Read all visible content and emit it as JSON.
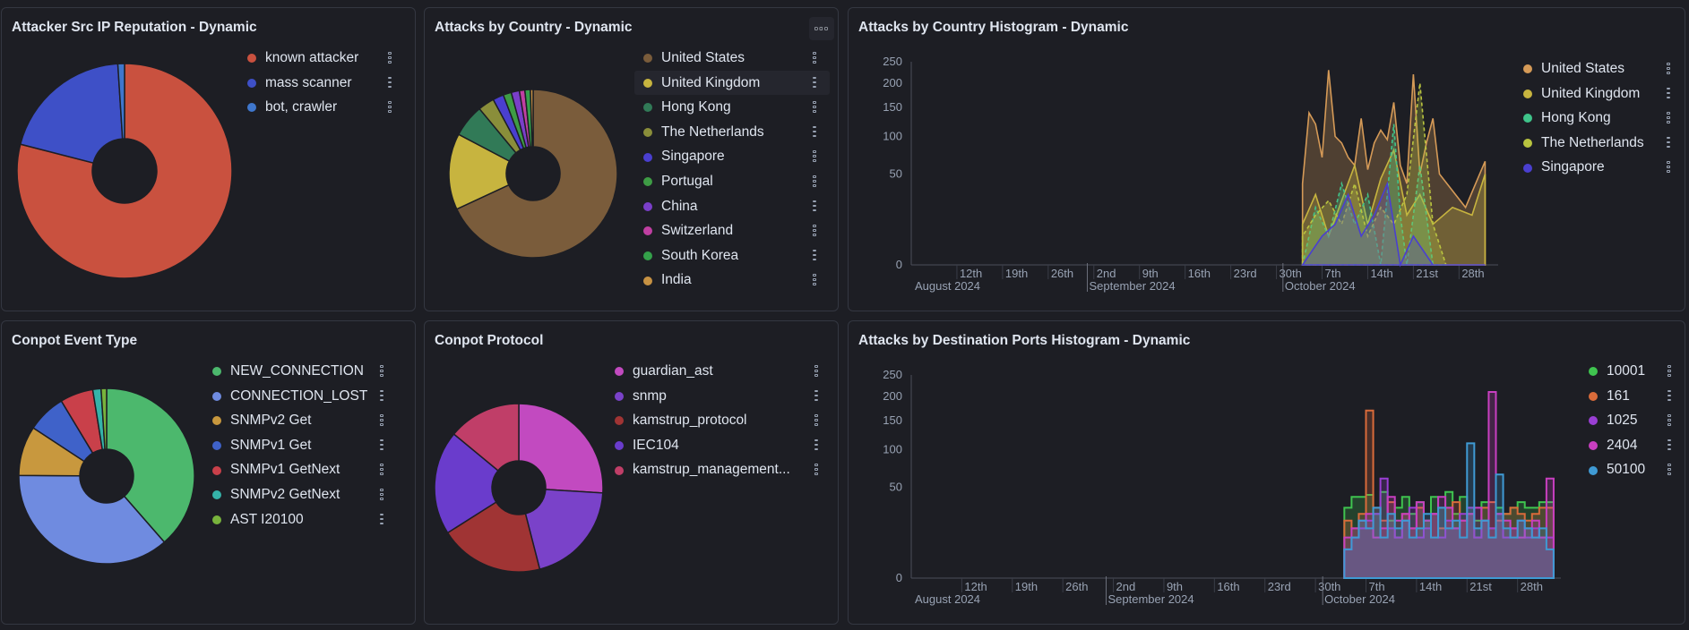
{
  "panels": {
    "reputation": {
      "title": "Attacker Src IP Reputation - Dynamic"
    },
    "countries": {
      "title": "Attacks by Country - Dynamic"
    },
    "country_hist": {
      "title": "Attacks by Country Histogram - Dynamic"
    },
    "event_type": {
      "title": "Conpot Event Type"
    },
    "protocol": {
      "title": "Conpot Protocol"
    },
    "ports_hist": {
      "title": "Attacks by Destination Ports Histogram - Dynamic"
    }
  },
  "chart_data": [
    {
      "type": "pie",
      "donut": true,
      "title": "Attacker Src IP Reputation - Dynamic",
      "legend_position": "right",
      "labels": [
        "known attacker",
        "mass scanner",
        "bot, crawler"
      ],
      "values": [
        79,
        20,
        1
      ],
      "colors": [
        "#c9513f",
        "#3e50c7",
        "#3f77cd"
      ]
    },
    {
      "type": "pie",
      "donut": true,
      "title": "Attacks by Country - Dynamic",
      "legend_position": "right",
      "labels": [
        "United States",
        "United Kingdom",
        "Hong Kong",
        "The Netherlands",
        "Singapore",
        "Portugal",
        "China",
        "Switzerland",
        "South Korea",
        "India"
      ],
      "values": [
        65,
        14,
        6,
        3,
        2,
        1.5,
        1.5,
        1,
        1,
        0.5
      ],
      "colors": [
        "#7a5c3b",
        "#c7b43f",
        "#317a57",
        "#8a8e3a",
        "#4a3fd0",
        "#3e9c45",
        "#7a3fc9",
        "#c03fa2",
        "#34a04a",
        "#c79243"
      ]
    },
    {
      "type": "area",
      "title": "Attacks by Country Histogram - Dynamic",
      "legend_position": "top-right",
      "y_scale": "sqrt",
      "ylim": [
        0,
        250
      ],
      "y_ticks": [
        0,
        50,
        100,
        150,
        200,
        250
      ],
      "x_tick_labels": [
        "12th",
        "19th",
        "26th",
        "2nd",
        "9th",
        "16th",
        "23rd",
        "30th",
        "7th",
        "14th",
        "21st",
        "28th"
      ],
      "x_major_labels": [
        "August 2024",
        "September 2024",
        "October 2024"
      ],
      "x_start": "2024-08-05",
      "x_end": "2024-11-03",
      "series": [
        {
          "name": "United States",
          "color": "#d59a57",
          "x": [
            "2024-10-04",
            "2024-10-05",
            "2024-10-06",
            "2024-10-07",
            "2024-10-08",
            "2024-10-09",
            "2024-10-10",
            "2024-10-11",
            "2024-10-12",
            "2024-10-13",
            "2024-10-14",
            "2024-10-15",
            "2024-10-16",
            "2024-10-17",
            "2024-10-18",
            "2024-10-19",
            "2024-10-20",
            "2024-10-21",
            "2024-10-22",
            "2024-10-23",
            "2024-10-24",
            "2024-10-25",
            "2024-10-29",
            "2024-11-01"
          ],
          "y": [
            40,
            140,
            120,
            70,
            230,
            100,
            90,
            70,
            60,
            130,
            55,
            90,
            110,
            95,
            160,
            60,
            40,
            220,
            50,
            90,
            130,
            50,
            20,
            65
          ]
        },
        {
          "name": "United Kingdom",
          "color": "#c7b43f",
          "x": [
            "2024-10-04",
            "2024-10-06",
            "2024-10-08",
            "2024-10-10",
            "2024-10-12",
            "2024-10-14",
            "2024-10-16",
            "2024-10-18",
            "2024-10-20",
            "2024-10-22",
            "2024-10-24",
            "2024-10-27",
            "2024-10-30",
            "2024-11-01"
          ],
          "y": [
            10,
            30,
            5,
            25,
            60,
            10,
            45,
            80,
            15,
            30,
            10,
            20,
            15,
            50
          ]
        },
        {
          "name": "Hong Kong",
          "color": "#3fc48a",
          "x": [
            "2024-10-04",
            "2024-10-06",
            "2024-10-08",
            "2024-10-10",
            "2024-10-12",
            "2024-10-14",
            "2024-10-16",
            "2024-10-18",
            "2024-10-19",
            "2024-10-20",
            "2024-10-22",
            "2024-10-24",
            "2024-10-26"
          ],
          "y": [
            0,
            20,
            5,
            40,
            10,
            30,
            0,
            120,
            15,
            0,
            60,
            0,
            0
          ]
        },
        {
          "name": "The Netherlands",
          "color": "#b9c43f",
          "x": [
            "2024-10-04",
            "2024-10-06",
            "2024-10-08",
            "2024-10-10",
            "2024-10-12",
            "2024-10-14",
            "2024-10-16",
            "2024-10-18",
            "2024-10-20",
            "2024-10-22",
            "2024-10-24",
            "2024-10-26"
          ],
          "y": [
            5,
            15,
            25,
            10,
            40,
            5,
            20,
            10,
            30,
            200,
            10,
            0
          ]
        },
        {
          "name": "Singapore",
          "color": "#4a3fd0",
          "x": [
            "2024-10-04",
            "2024-10-07",
            "2024-10-09",
            "2024-10-11",
            "2024-10-13",
            "2024-10-15",
            "2024-10-17",
            "2024-10-19",
            "2024-10-21",
            "2024-10-24",
            "2024-10-28",
            "2024-11-01"
          ],
          "y": [
            0,
            5,
            10,
            30,
            5,
            15,
            40,
            0,
            5,
            0,
            0,
            0
          ]
        }
      ]
    },
    {
      "type": "pie",
      "donut": true,
      "title": "Conpot Event Type",
      "legend_position": "right",
      "labels": [
        "NEW_CONNECTION",
        "CONNECTION_LOST",
        "SNMPv2 Get",
        "SNMPv1 Get",
        "SNMPv1 GetNext",
        "SNMPv2 GetNext",
        "AST I20100"
      ],
      "values": [
        38,
        36,
        9,
        7,
        6,
        1.5,
        1
      ],
      "colors": [
        "#4cb86d",
        "#6f8be0",
        "#c8983e",
        "#3f62c9",
        "#c9404a",
        "#35b3a9",
        "#78b33c"
      ]
    },
    {
      "type": "pie",
      "donut": true,
      "title": "Conpot Protocol",
      "legend_position": "right",
      "labels": [
        "guardian_ast",
        "snmp",
        "kamstrup_protocol",
        "IEC104",
        "kamstrup_management..."
      ],
      "values": [
        26,
        20,
        20,
        20,
        14
      ],
      "colors": [
        "#c24ac0",
        "#7a42c9",
        "#a03434",
        "#6a3ccc",
        "#c03e68"
      ]
    },
    {
      "type": "bar",
      "title": "Attacks by Destination Ports Histogram - Dynamic",
      "legend_position": "top-right",
      "y_scale": "sqrt",
      "ylim": [
        0,
        250
      ],
      "y_ticks": [
        0,
        50,
        100,
        150,
        200,
        250
      ],
      "x_tick_labels": [
        "12th",
        "19th",
        "26th",
        "2nd",
        "9th",
        "16th",
        "23rd",
        "30th",
        "7th",
        "14th",
        "21st",
        "28th"
      ],
      "x_major_labels": [
        "August 2024",
        "September 2024",
        "October 2024"
      ],
      "x_start": "2024-08-05",
      "x_end": "2024-11-03",
      "series": [
        {
          "name": "10001",
          "color": "#3fc44f",
          "x": [
            "2024-10-04",
            "2024-10-05",
            "2024-10-06",
            "2024-10-07",
            "2024-10-08",
            "2024-10-09",
            "2024-10-10",
            "2024-10-11",
            "2024-10-12",
            "2024-10-13",
            "2024-10-14",
            "2024-10-15",
            "2024-10-16",
            "2024-10-17",
            "2024-10-18",
            "2024-10-19",
            "2024-10-20",
            "2024-10-21",
            "2024-10-22",
            "2024-10-23",
            "2024-10-24",
            "2024-10-25",
            "2024-10-26",
            "2024-10-27",
            "2024-10-28",
            "2024-10-29",
            "2024-10-30",
            "2024-10-31",
            "2024-11-01"
          ],
          "y": [
            30,
            40,
            40,
            42,
            25,
            45,
            20,
            30,
            40,
            25,
            35,
            20,
            40,
            30,
            45,
            25,
            40,
            30,
            20,
            35,
            15,
            30,
            25,
            30,
            35,
            30,
            30,
            35,
            35
          ]
        },
        {
          "name": "161",
          "color": "#d96b3a",
          "x": [
            "2024-10-04",
            "2024-10-05",
            "2024-10-06",
            "2024-10-07",
            "2024-10-08",
            "2024-10-09",
            "2024-10-10",
            "2024-10-11",
            "2024-10-12",
            "2024-10-13",
            "2024-10-14",
            "2024-10-15",
            "2024-10-16",
            "2024-10-17",
            "2024-10-18",
            "2024-10-19",
            "2024-10-20",
            "2024-10-21",
            "2024-10-22",
            "2024-10-23",
            "2024-10-24",
            "2024-10-25",
            "2024-10-26",
            "2024-10-27",
            "2024-10-28",
            "2024-10-29",
            "2024-10-30",
            "2024-10-31",
            "2024-11-01"
          ],
          "y": [
            20,
            15,
            25,
            170,
            30,
            20,
            35,
            10,
            25,
            15,
            30,
            20,
            25,
            15,
            30,
            35,
            20,
            25,
            10,
            30,
            35,
            20,
            25,
            30,
            25,
            20,
            25,
            30,
            30
          ]
        },
        {
          "name": "1025",
          "color": "#9a3fd4",
          "x": [
            "2024-10-04",
            "2024-10-05",
            "2024-10-06",
            "2024-10-07",
            "2024-10-08",
            "2024-10-09",
            "2024-10-10",
            "2024-10-11",
            "2024-10-12",
            "2024-10-13",
            "2024-10-14",
            "2024-10-15",
            "2024-10-16",
            "2024-10-17",
            "2024-10-18",
            "2024-10-19",
            "2024-10-20",
            "2024-10-21",
            "2024-10-22",
            "2024-10-23",
            "2024-10-24",
            "2024-10-25",
            "2024-10-26",
            "2024-10-27",
            "2024-10-28",
            "2024-10-29",
            "2024-10-30",
            "2024-10-31",
            "2024-11-01"
          ],
          "y": [
            5,
            10,
            15,
            20,
            25,
            60,
            15,
            10,
            20,
            30,
            10,
            15,
            25,
            10,
            20,
            15,
            25,
            30,
            10,
            20,
            15,
            25,
            10,
            15,
            20,
            10,
            15,
            10,
            10
          ]
        },
        {
          "name": "2404",
          "color": "#c83fc0",
          "x": [
            "2024-10-04",
            "2024-10-05",
            "2024-10-06",
            "2024-10-07",
            "2024-10-08",
            "2024-10-09",
            "2024-10-10",
            "2024-10-11",
            "2024-10-12",
            "2024-10-13",
            "2024-10-14",
            "2024-10-15",
            "2024-10-16",
            "2024-10-17",
            "2024-10-18",
            "2024-10-19",
            "2024-10-20",
            "2024-10-21",
            "2024-10-22",
            "2024-10-23",
            "2024-10-24",
            "2024-10-25",
            "2024-10-26",
            "2024-10-27",
            "2024-10-28",
            "2024-10-29",
            "2024-10-30",
            "2024-10-31",
            "2024-11-01"
          ],
          "y": [
            10,
            15,
            20,
            25,
            10,
            15,
            40,
            20,
            25,
            15,
            35,
            20,
            25,
            40,
            30,
            15,
            20,
            25,
            30,
            20,
            210,
            25,
            20,
            15,
            10,
            15,
            20,
            10,
            60
          ]
        },
        {
          "name": "50100",
          "color": "#3f9ad4",
          "x": [
            "2024-10-04",
            "2024-10-05",
            "2024-10-06",
            "2024-10-07",
            "2024-10-08",
            "2024-10-09",
            "2024-10-10",
            "2024-10-11",
            "2024-10-12",
            "2024-10-13",
            "2024-10-14",
            "2024-10-15",
            "2024-10-16",
            "2024-10-17",
            "2024-10-18",
            "2024-10-19",
            "2024-10-20",
            "2024-10-21",
            "2024-10-22",
            "2024-10-23",
            "2024-10-24",
            "2024-10-25",
            "2024-10-26",
            "2024-10-27",
            "2024-10-28",
            "2024-10-29",
            "2024-10-30",
            "2024-10-31",
            "2024-11-01"
          ],
          "y": [
            5,
            10,
            20,
            15,
            30,
            10,
            25,
            15,
            20,
            10,
            15,
            25,
            10,
            30,
            15,
            20,
            10,
            110,
            15,
            20,
            10,
            65,
            15,
            10,
            20,
            15,
            10,
            15,
            5
          ]
        }
      ]
    }
  ]
}
